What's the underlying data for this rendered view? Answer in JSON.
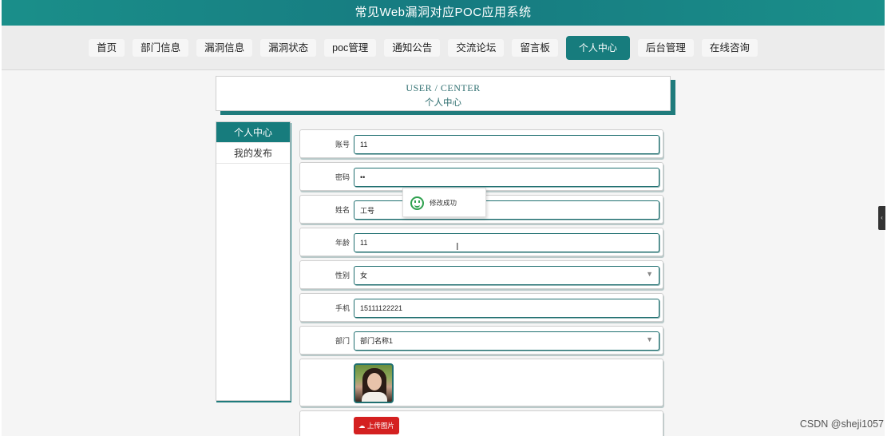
{
  "app_title": "常见Web漏洞对应POC应用系统",
  "nav": [
    {
      "label": "首页"
    },
    {
      "label": "部门信息"
    },
    {
      "label": "漏洞信息"
    },
    {
      "label": "漏洞状态"
    },
    {
      "label": "poc管理"
    },
    {
      "label": "通知公告"
    },
    {
      "label": "交流论坛"
    },
    {
      "label": "留言板"
    },
    {
      "label": "个人中心",
      "active": true
    },
    {
      "label": "后台管理"
    },
    {
      "label": "在线咨询"
    }
  ],
  "banner": {
    "en": "USER / CENTER",
    "cn": "个人中心"
  },
  "sidebar": {
    "items": [
      {
        "label": "个人中心",
        "active": true
      },
      {
        "label": "我的发布"
      }
    ]
  },
  "form": {
    "account_label": "账号",
    "account_value": "11",
    "password_label": "密码",
    "password_value": "••",
    "name_label": "姓名",
    "name_value": "工号",
    "age_label": "年龄",
    "age_value": "11",
    "gender_label": "性别",
    "gender_value": "女",
    "phone_label": "手机",
    "phone_value": "15111122221",
    "dept_label": "部门",
    "dept_value": "部门名称1",
    "upload_label": "上传图片"
  },
  "toast": {
    "message": "修改成功"
  },
  "icons": {
    "toast": "smile-icon",
    "dropdown": "chevron-down-icon",
    "upload": "cloud-upload-icon"
  },
  "watermark": "CSDN @sheji1057",
  "colors": {
    "primary": "#177c7d",
    "upload": "#d42020",
    "success": "#2fa14f"
  }
}
